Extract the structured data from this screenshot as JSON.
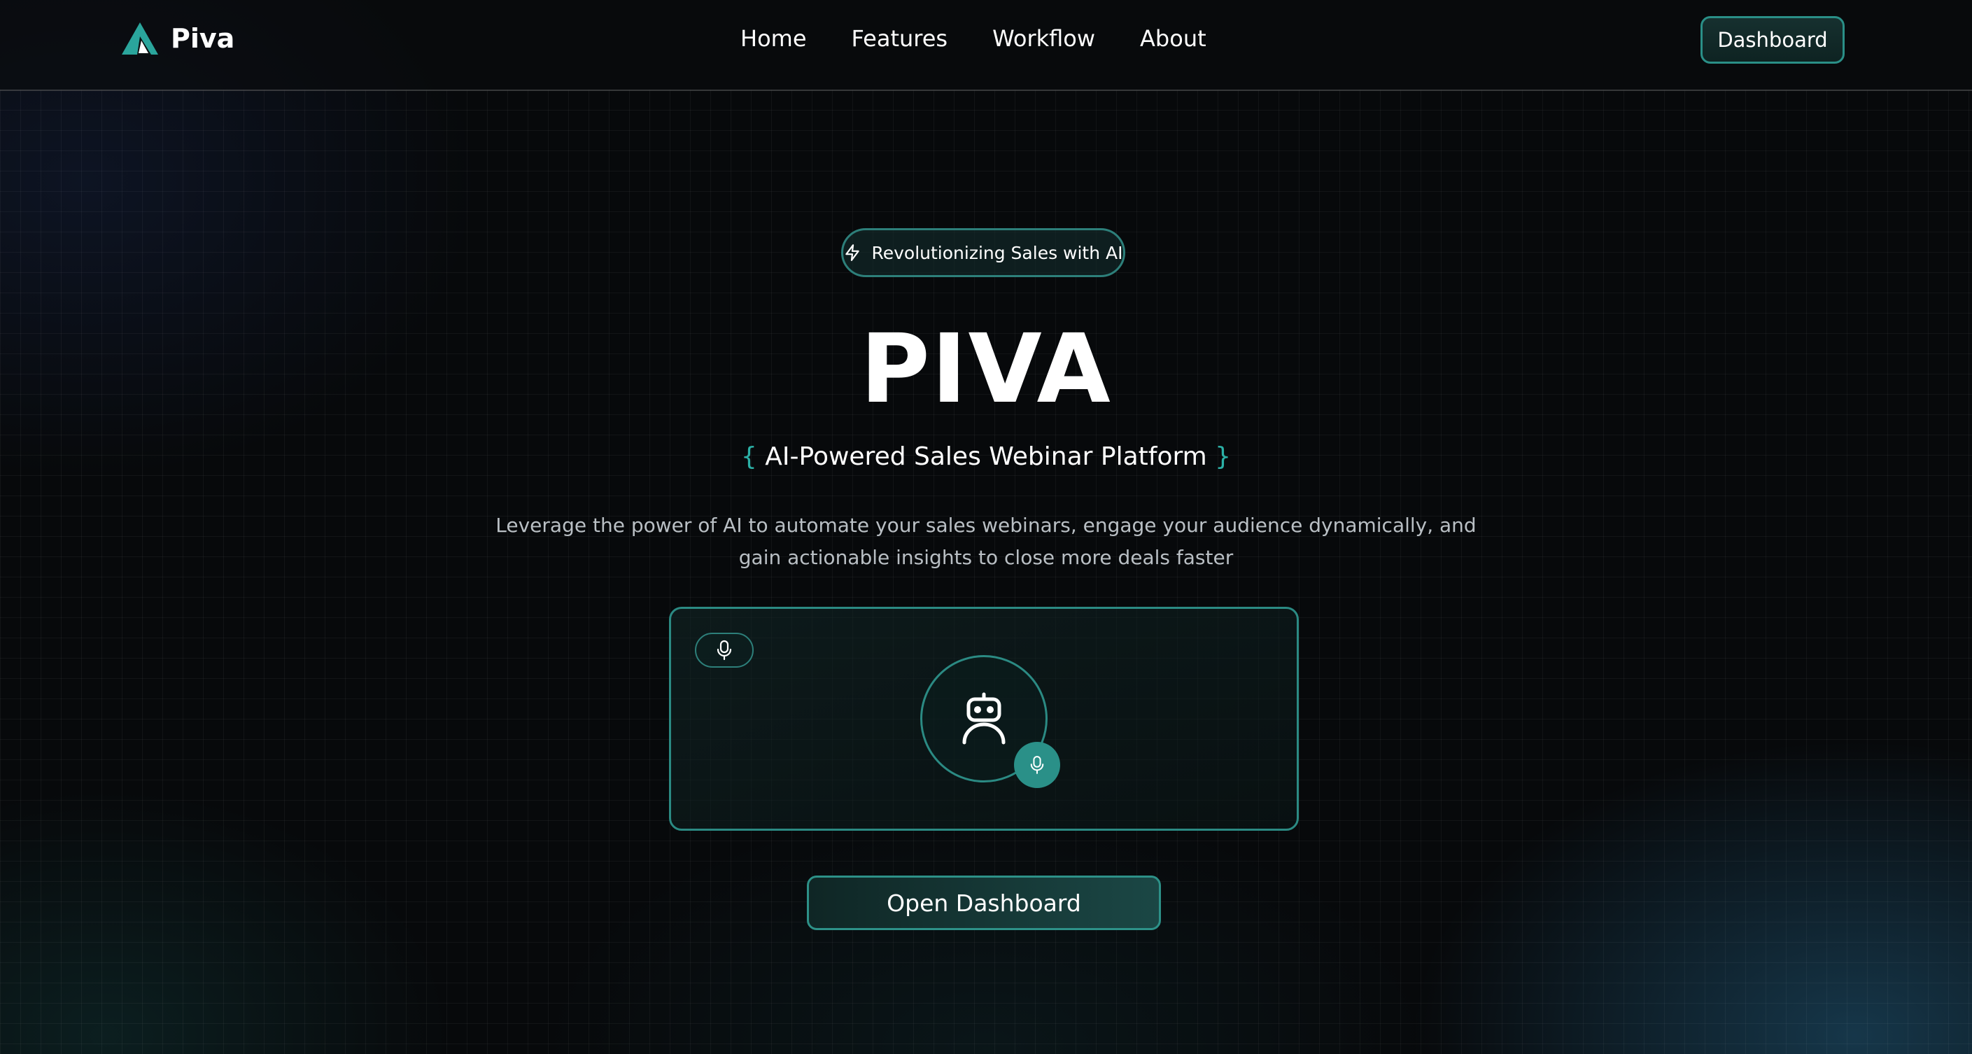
{
  "brand": {
    "name": "Piva",
    "accent": "#2bb0a6"
  },
  "nav": {
    "items": [
      {
        "label": "Home"
      },
      {
        "label": "Features"
      },
      {
        "label": "Workflow"
      },
      {
        "label": "About"
      }
    ]
  },
  "header": {
    "dashboard_label": "Dashboard"
  },
  "hero": {
    "badge_icon": "lightning-icon",
    "badge_text": "Revolutionizing Sales with AI",
    "title": "PIVA",
    "subtitle_open": "{",
    "subtitle": "AI-Powered Sales Webinar Platform",
    "subtitle_close": "}",
    "description": "Leverage the power of AI to automate your sales webinars, engage your audience dynamically, and gain actionable insights to close more deals faster"
  },
  "demo": {
    "mic_icon": "microphone-icon",
    "avatar_icon": "robot-icon"
  },
  "cta": {
    "open_dashboard_label": "Open Dashboard"
  }
}
